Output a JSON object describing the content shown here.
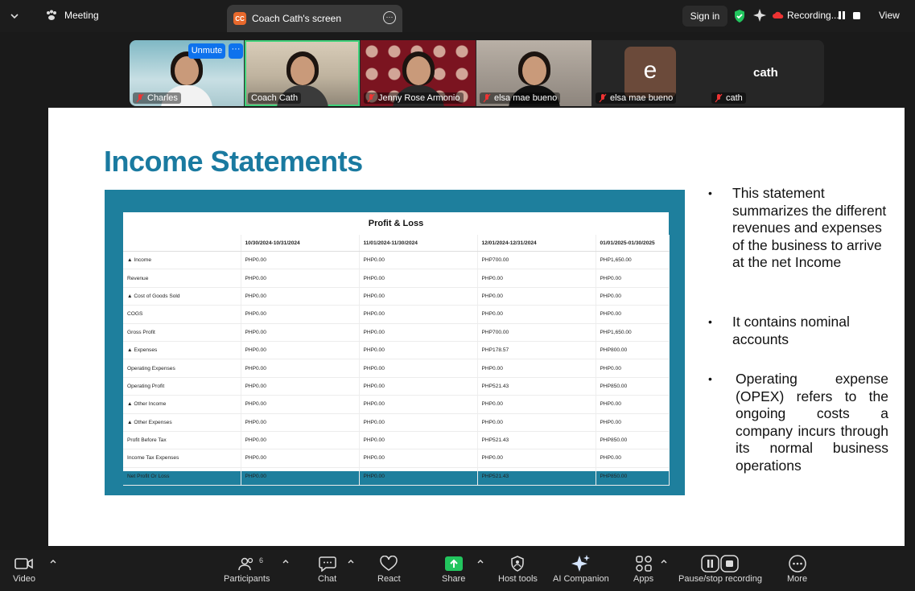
{
  "topbar": {
    "meeting_label": "Meeting",
    "tab_badge": "CC",
    "tab_title": "Coach Cath's screen",
    "sign_in": "Sign in",
    "recording": "Recording...",
    "view": "View"
  },
  "participants": [
    {
      "name": "Charles",
      "unmute_label": "Unmute",
      "more_label": "···"
    },
    {
      "name": "Coach Cath"
    },
    {
      "name": "Jenny Rose Armonio"
    },
    {
      "name": "elsa mae bueno"
    },
    {
      "name": "elsa mae bueno",
      "avatar_letter": "e"
    },
    {
      "name": "cath",
      "display": "cath"
    }
  ],
  "slide": {
    "title": "Income Statements",
    "table": {
      "title": "Profit & Loss",
      "columns": [
        "",
        "10/30/2024-10/31/2024",
        "11/01/2024-11/30/2024",
        "12/01/2024-12/31/2024",
        "01/01/2025-01/30/2025"
      ],
      "rows": [
        [
          "▲ Income",
          "PHP0.00",
          "PHP0.00",
          "PHP700.00",
          "PHP1,650.00"
        ],
        [
          "Revenue",
          "PHP0.00",
          "PHP0.00",
          "PHP0.00",
          "PHP0.00"
        ],
        [
          "▲ Cost of Goods Sold",
          "PHP0.00",
          "PHP0.00",
          "PHP0.00",
          "PHP0.00"
        ],
        [
          "COGS",
          "PHP0.00",
          "PHP0.00",
          "PHP0.00",
          "PHP0.00"
        ],
        [
          "Gross Profit",
          "PHP0.00",
          "PHP0.00",
          "PHP700.00",
          "PHP1,650.00"
        ],
        [
          "▲ Expenses",
          "PHP0.00",
          "PHP0.00",
          "PHP178.57",
          "PHP800.00"
        ],
        [
          "Operating Expenses",
          "PHP0.00",
          "PHP0.00",
          "PHP0.00",
          "PHP0.00"
        ],
        [
          "Operating Profit",
          "PHP0.00",
          "PHP0.00",
          "PHP521.43",
          "PHP850.00"
        ],
        [
          "▲ Other Income",
          "PHP0.00",
          "PHP0.00",
          "PHP0.00",
          "PHP0.00"
        ],
        [
          "▲ Other Expenses",
          "PHP0.00",
          "PHP0.00",
          "PHP0.00",
          "PHP0.00"
        ],
        [
          "Profit Before Tax",
          "PHP0.00",
          "PHP0.00",
          "PHP521.43",
          "PHP850.00"
        ],
        [
          "Income Tax Expenses",
          "PHP0.00",
          "PHP0.00",
          "PHP0.00",
          "PHP0.00"
        ],
        [
          "Net Profit Or Loss",
          "PHP0.00",
          "PHP0.00",
          "PHP521.43",
          "PHP850.00"
        ]
      ]
    },
    "bullets": [
      "This statement summarizes the different revenues and expenses of the business to arrive at the net Income",
      "It contains nominal accounts",
      "Operating expense (OPEX) refers to the ongoing costs a company incurs through its normal business operations"
    ]
  },
  "toolbar": {
    "video": "Video",
    "participants": "Participants",
    "participants_count": "6",
    "chat": "Chat",
    "react": "React",
    "share": "Share",
    "host_tools": "Host tools",
    "ai_companion": "AI Companion",
    "apps": "Apps",
    "pause_stop": "Pause/stop recording",
    "more": "More"
  },
  "colors": {
    "accent_blue": "#0e72ed",
    "share_green": "#22c55e",
    "slide_title": "#1a7aa0",
    "table_frame": "#1e7f9d",
    "active_speaker": "#3fd17a"
  }
}
